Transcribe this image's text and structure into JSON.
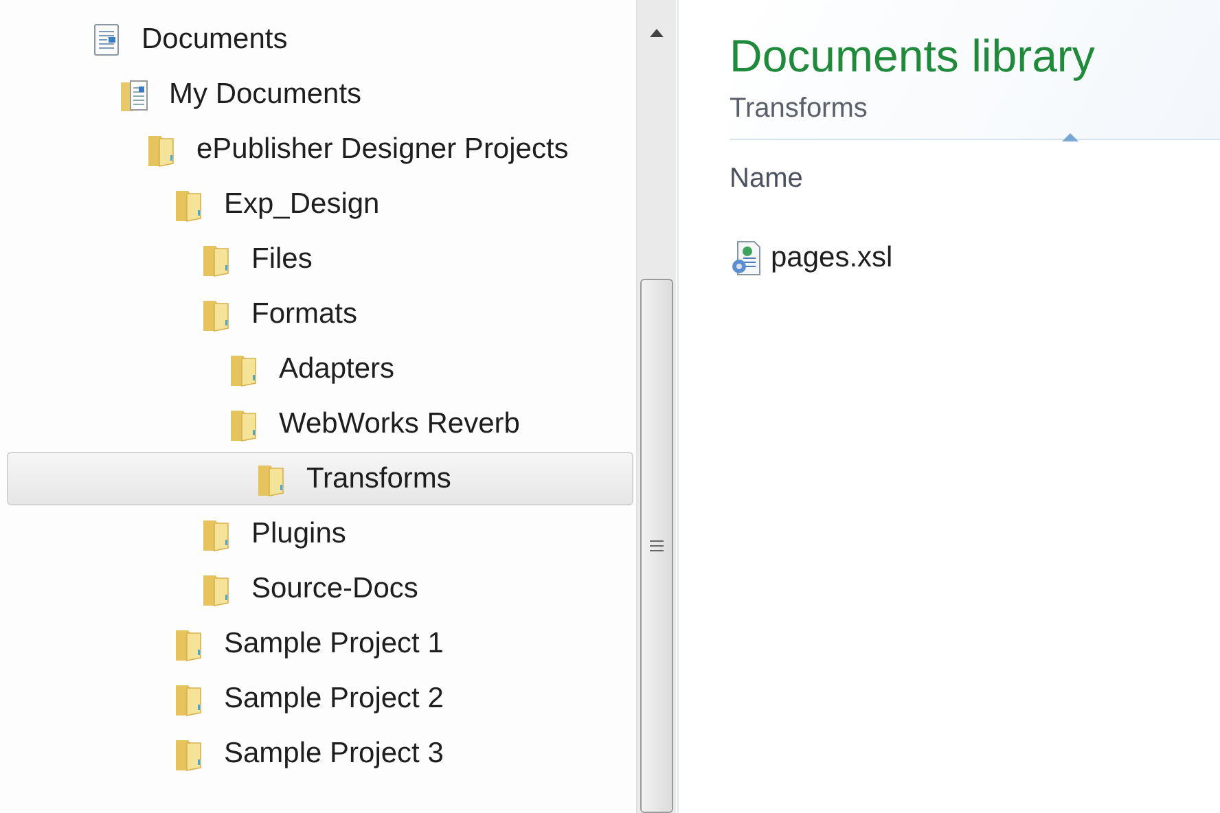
{
  "navigation_tree": [
    {
      "label": "Documents",
      "kind": "library",
      "selected": false,
      "children": [
        {
          "label": "My Documents",
          "kind": "documents-folder",
          "selected": false,
          "children": [
            {
              "label": "ePublisher Designer Projects",
              "kind": "folder",
              "selected": false,
              "children": [
                {
                  "label": "Exp_Design",
                  "kind": "folder",
                  "selected": false,
                  "children": [
                    {
                      "label": "Files",
                      "kind": "folder",
                      "selected": false
                    },
                    {
                      "label": "Formats",
                      "kind": "folder",
                      "selected": false,
                      "children": [
                        {
                          "label": "Adapters",
                          "kind": "folder",
                          "selected": false
                        },
                        {
                          "label": "WebWorks Reverb",
                          "kind": "folder",
                          "selected": false,
                          "children": [
                            {
                              "label": "Transforms",
                              "kind": "folder",
                              "selected": true
                            }
                          ]
                        }
                      ]
                    },
                    {
                      "label": "Plugins",
                      "kind": "folder",
                      "selected": false
                    },
                    {
                      "label": "Source-Docs",
                      "kind": "folder",
                      "selected": false
                    }
                  ]
                },
                {
                  "label": "Sample Project 1",
                  "kind": "folder",
                  "selected": false
                },
                {
                  "label": "Sample Project 2",
                  "kind": "folder",
                  "selected": false
                },
                {
                  "label": "Sample Project 3",
                  "kind": "folder",
                  "selected": false
                }
              ]
            }
          ]
        }
      ]
    }
  ],
  "content": {
    "title": "Documents library",
    "subtitle": "Transforms",
    "columns": [
      {
        "label": "Name",
        "sorted": true
      }
    ],
    "files": [
      {
        "name": "pages.xsl",
        "kind": "xsl"
      }
    ]
  }
}
